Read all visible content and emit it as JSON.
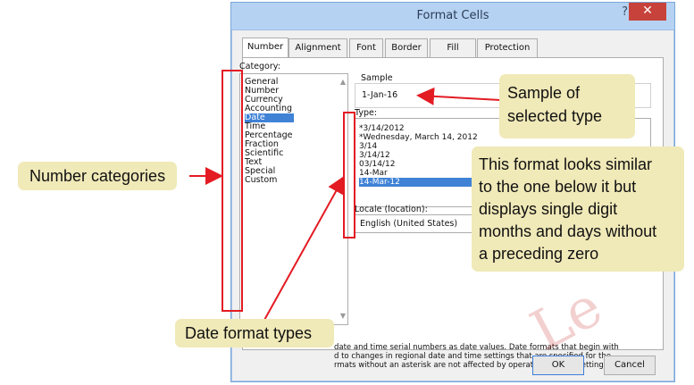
{
  "dialog": {
    "title": "Format Cells",
    "help_label": "?",
    "close_label": "✕",
    "tabs": [
      "Number",
      "Alignment",
      "Font",
      "Border",
      "Fill",
      "Protection"
    ],
    "category_label": "Category:",
    "categories": [
      "General",
      "Number",
      "Currency",
      "Accounting",
      "Date",
      "Time",
      "Percentage",
      "Fraction",
      "Scientific",
      "Text",
      "Special",
      "Custom"
    ],
    "selected_category": "Date",
    "sample_label": "Sample",
    "sample_value": "1-Jan-16",
    "type_label": "Type:",
    "types": [
      "*3/14/2012",
      "*Wednesday, March 14, 2012",
      "3/14",
      "3/14/12",
      "03/14/12",
      "14-Mar",
      "14-Mar-12"
    ],
    "selected_type": "14-Mar-12",
    "locale_label": "Locale (location):",
    "locale_value": "English (United States)",
    "description_lines": [
      "date and time serial numbers as date values.  Date formats that begin with",
      "d to changes in regional date and time settings that are specified for the",
      "rmats without an asterisk are not affected by operating system settings."
    ],
    "ok_label": "OK",
    "cancel_label": "Cancel"
  },
  "callouts": {
    "number_categories": "Number categories",
    "date_format_types": "Date format types",
    "sample_line1": "Sample of",
    "sample_line2": "selected type",
    "format_line1": "This format looks similar",
    "format_line2": "to the one below it but",
    "format_line3": "displays single digit",
    "format_line4": "months and days without",
    "format_line5": "a preceding zero"
  },
  "colors": {
    "titlebar": "#b6d2f2",
    "close": "#c7423a",
    "selection": "#3f82d6",
    "callout": "#f0e9b8",
    "annotation": "#e31b23"
  }
}
